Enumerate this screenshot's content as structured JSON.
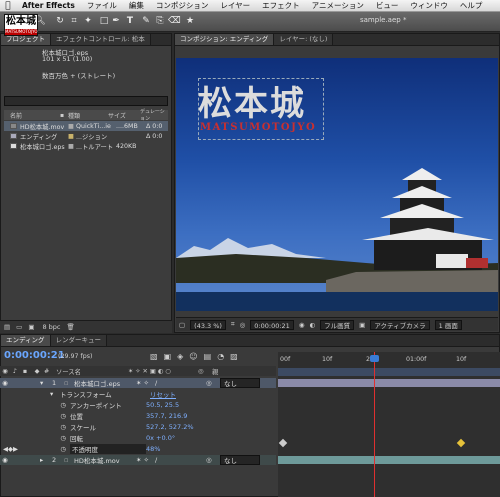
{
  "menubar": {
    "app": "After Effects",
    "items": [
      "ファイル",
      "編集",
      "コンポジション",
      "レイヤー",
      "エフェクト",
      "アニメーション",
      "ビュー",
      "ウィンドウ",
      "ヘルプ"
    ]
  },
  "window": {
    "title": "sample.aep *"
  },
  "project": {
    "tabs": [
      "プロジェクト",
      "エフェクトコントロール: 松本"
    ],
    "thumb_kanji": "松本城",
    "thumb_sub": "MATSUMOTOJYO",
    "item_name": "松本城ロゴ.eps",
    "item_dims": "101 x 51 (1.00)",
    "item_color": "数百万色 + (ストレート)",
    "columns": [
      "名前",
      "種類",
      "サイズ",
      "デュレーション"
    ],
    "rows": [
      {
        "name": "HD松本城.mov",
        "type": "QuickTi...ie",
        "size": "....6MB",
        "dur": "Δ 0:0"
      },
      {
        "name": "エンディング",
        "type": "...ジション",
        "size": "",
        "dur": "Δ 0:0"
      },
      {
        "name": "松本城ロゴ.eps",
        "type": "...トルアート",
        "size": "420KB",
        "dur": ""
      }
    ],
    "bpc": "8 bpc"
  },
  "comp": {
    "tabs": [
      "コンポジション: エンディング",
      "レイヤー: (なし)"
    ],
    "title_kanji": "松本城",
    "title_sub": "MATSUMOTOJYO",
    "zoom": "(43.3 %)",
    "timecode": "0:00:00:21",
    "resolution": "フル画質",
    "camera": "アクティブカメラ",
    "views": "1 画面"
  },
  "timeline": {
    "tabs": [
      "エンディング",
      "レンダーキュー"
    ],
    "time": "0:00:00:21",
    "fps": "(29.97 fps)",
    "col_num": "#",
    "col_source": "ソース名",
    "col_parent": "親",
    "ruler": [
      "00f",
      "10f",
      "20f",
      "01:00f",
      "10f"
    ],
    "layer1": {
      "num": "1",
      "name": "松本城ロゴ.eps",
      "parent": "なし"
    },
    "transform": "トランスフォーム",
    "reset": "リセット",
    "props": [
      {
        "name": "アンカーポイント",
        "value": "50.5, 25.5"
      },
      {
        "name": "位置",
        "value": "357.7, 216.9"
      },
      {
        "name": "スケール",
        "value": "527.2, 527.2%"
      },
      {
        "name": "回転",
        "value": "0x +0.0°"
      },
      {
        "name": "不透明度",
        "value": "48%"
      }
    ],
    "layer2": {
      "num": "2",
      "name": "HD松本城.mov",
      "parent": "なし"
    }
  },
  "colors": {
    "accent": "#3a7bd5",
    "timecode": "#6aa6ff",
    "cti": "#e03030",
    "layer1_bar": "#8a8aa8",
    "layer2_bar": "#6e9a9a"
  }
}
